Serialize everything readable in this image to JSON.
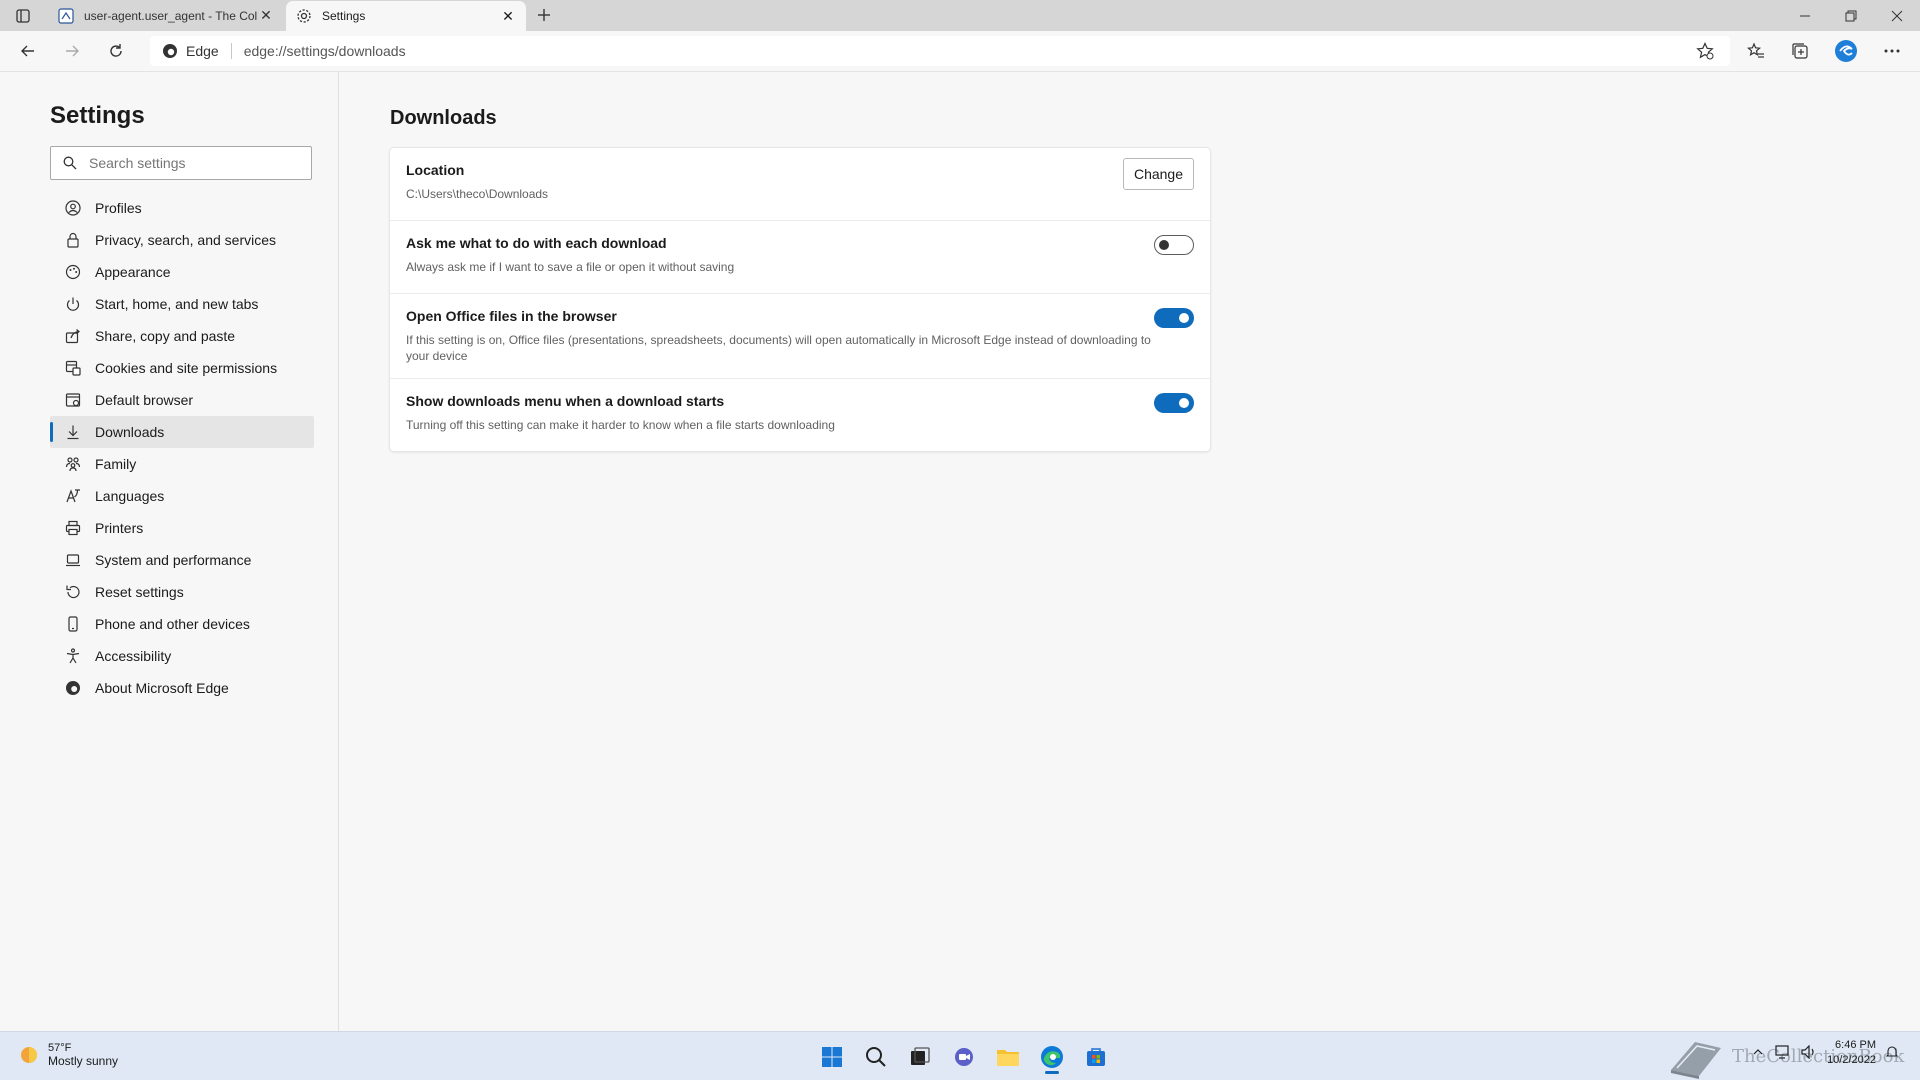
{
  "browser": {
    "tabs": [
      {
        "title": "user-agent.user_agent - The Coll",
        "active": false
      },
      {
        "title": "Settings",
        "active": true
      }
    ],
    "address": {
      "badge": "Edge",
      "url": "edge://settings/downloads"
    }
  },
  "sidebar": {
    "title": "Settings",
    "search_placeholder": "Search settings",
    "items": [
      {
        "label": "Profiles",
        "icon": "profile-icon"
      },
      {
        "label": "Privacy, search, and services",
        "icon": "lock-icon"
      },
      {
        "label": "Appearance",
        "icon": "appearance-icon"
      },
      {
        "label": "Start, home, and new tabs",
        "icon": "power-icon"
      },
      {
        "label": "Share, copy and paste",
        "icon": "share-icon"
      },
      {
        "label": "Cookies and site permissions",
        "icon": "cookies-icon"
      },
      {
        "label": "Default browser",
        "icon": "browser-icon"
      },
      {
        "label": "Downloads",
        "icon": "download-icon",
        "active": true
      },
      {
        "label": "Family",
        "icon": "family-icon"
      },
      {
        "label": "Languages",
        "icon": "language-icon"
      },
      {
        "label": "Printers",
        "icon": "printer-icon"
      },
      {
        "label": "System and performance",
        "icon": "laptop-icon"
      },
      {
        "label": "Reset settings",
        "icon": "reset-icon"
      },
      {
        "label": "Phone and other devices",
        "icon": "phone-icon"
      },
      {
        "label": "Accessibility",
        "icon": "accessibility-icon"
      },
      {
        "label": "About Microsoft Edge",
        "icon": "edge-icon"
      }
    ]
  },
  "main": {
    "title": "Downloads",
    "location": {
      "label": "Location",
      "path": "C:\\Users\\theco\\Downloads",
      "button": "Change"
    },
    "settings": [
      {
        "label": "Ask me what to do with each download",
        "desc": "Always ask me if I want to save a file or open it without saving",
        "on": false
      },
      {
        "label": "Open Office files in the browser",
        "desc": "If this setting is on, Office files (presentations, spreadsheets, documents) will open automatically in Microsoft Edge instead of downloading to your device",
        "on": true
      },
      {
        "label": "Show downloads menu when a download starts",
        "desc": "Turning off this setting can make it harder to know when a file starts downloading",
        "on": true
      }
    ]
  },
  "taskbar": {
    "weather_temp": "57°F",
    "weather_desc": "Mostly sunny",
    "time": "6:46 PM",
    "date": "10/2/2022",
    "watermark": "TheCollectionBook"
  },
  "colors": {
    "accent": "#0f6cbd",
    "sidebar_active_bg": "#e5e5e5",
    "page_bg": "#f7f7f7"
  }
}
